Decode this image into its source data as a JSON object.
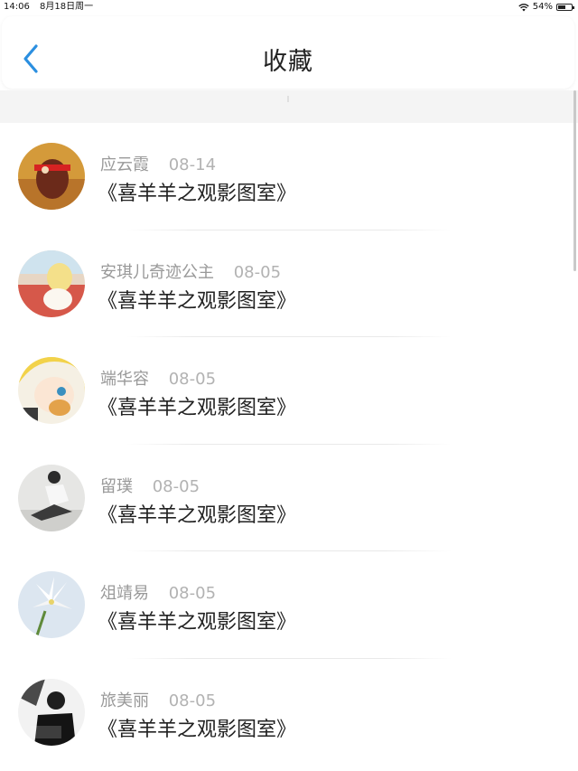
{
  "status_bar": {
    "time": "14:06",
    "date": "8月18日周一",
    "battery": "54%"
  },
  "header": {
    "title": "收藏"
  },
  "favorites": [
    {
      "name": "应云霞",
      "date": "08-14",
      "title": "《喜羊羊之观影图室》"
    },
    {
      "name": "安琪儿奇迹公主",
      "date": "08-05",
      "title": "《喜羊羊之观影图室》"
    },
    {
      "name": "端华容",
      "date": "08-05",
      "title": "《喜羊羊之观影图室》"
    },
    {
      "name": "留璞",
      "date": "08-05",
      "title": "《喜羊羊之观影图室》"
    },
    {
      "name": "俎靖易",
      "date": "08-05",
      "title": "《喜羊羊之观影图室》"
    },
    {
      "name": "旅美丽",
      "date": "08-05",
      "title": "《喜羊羊之观影图室》"
    }
  ],
  "colors": {
    "accent": "#2b8fe0",
    "background": "#ffffff",
    "band": "#f4f4f4"
  }
}
